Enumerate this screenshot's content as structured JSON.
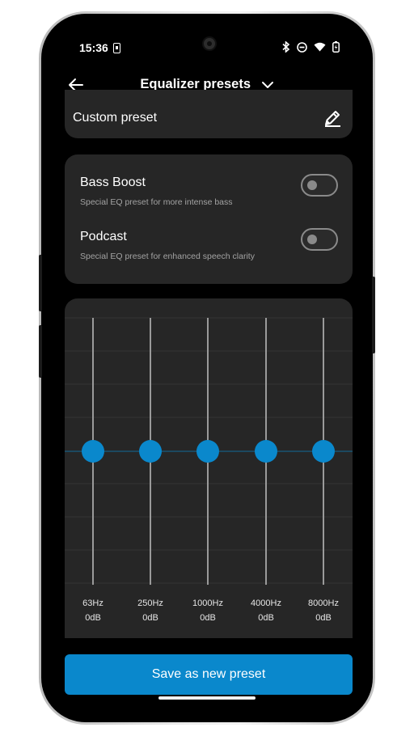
{
  "status_bar": {
    "time": "15:36",
    "icons": [
      "sim-card-icon",
      "bluetooth-icon",
      "do-not-disturb-icon",
      "wifi-icon",
      "battery-charging-icon"
    ]
  },
  "header": {
    "title": "Equalizer presets",
    "back_icon": "arrow-left-icon",
    "dropdown_icon": "chevron-down-icon"
  },
  "custom_preset": {
    "label": "Custom preset",
    "edit_icon": "pencil-icon"
  },
  "presets": [
    {
      "title": "Bass Boost",
      "subtitle": "Special EQ preset for more intense bass",
      "enabled": false
    },
    {
      "title": "Podcast",
      "subtitle": "Special EQ preset for enhanced speech clarity",
      "enabled": false
    }
  ],
  "equalizer": {
    "accent_color": "#0a88cc",
    "bands": [
      {
        "freq": "63Hz",
        "gain": "0dB",
        "gain_value": 0
      },
      {
        "freq": "250Hz",
        "gain": "0dB",
        "gain_value": 0
      },
      {
        "freq": "1000Hz",
        "gain": "0dB",
        "gain_value": 0
      },
      {
        "freq": "4000Hz",
        "gain": "0dB",
        "gain_value": 0
      },
      {
        "freq": "8000Hz",
        "gain": "0dB",
        "gain_value": 0
      }
    ]
  },
  "save_button": {
    "label": "Save as new preset"
  },
  "colors": {
    "background": "#000000",
    "card": "#262626",
    "accent": "#0a88cc"
  }
}
